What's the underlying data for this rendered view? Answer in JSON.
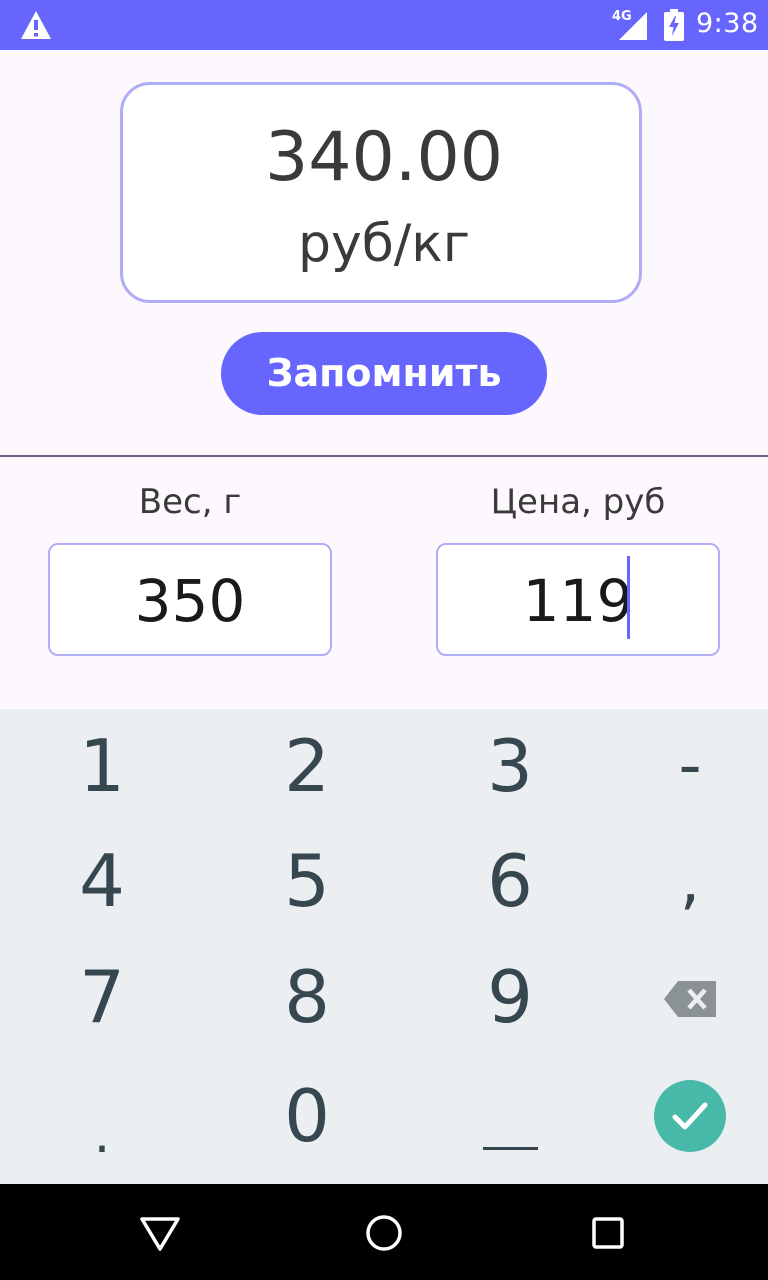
{
  "status_bar": {
    "network": "4G",
    "time": "9:38",
    "color": "#6666ff"
  },
  "result": {
    "value": "340.00",
    "unit": "руб/кг"
  },
  "save_button": {
    "label": "Запомнить",
    "color": "#6666ff"
  },
  "weight": {
    "label": "Вес, г",
    "value": "350"
  },
  "price": {
    "label": "Цена, руб",
    "value": "119"
  },
  "keyboard": {
    "rows": [
      [
        "1",
        "2",
        "3",
        "-"
      ],
      [
        "4",
        "5",
        "6",
        ","
      ],
      [
        "7",
        "8",
        "9"
      ],
      [
        ".",
        "0"
      ]
    ],
    "icons": [
      "backspace-icon",
      "space-bar-icon",
      "checkmark-icon"
    ],
    "done_color": "#48b8a9"
  },
  "nav": {
    "icons": [
      "back-icon",
      "home-icon",
      "recents-icon"
    ]
  }
}
